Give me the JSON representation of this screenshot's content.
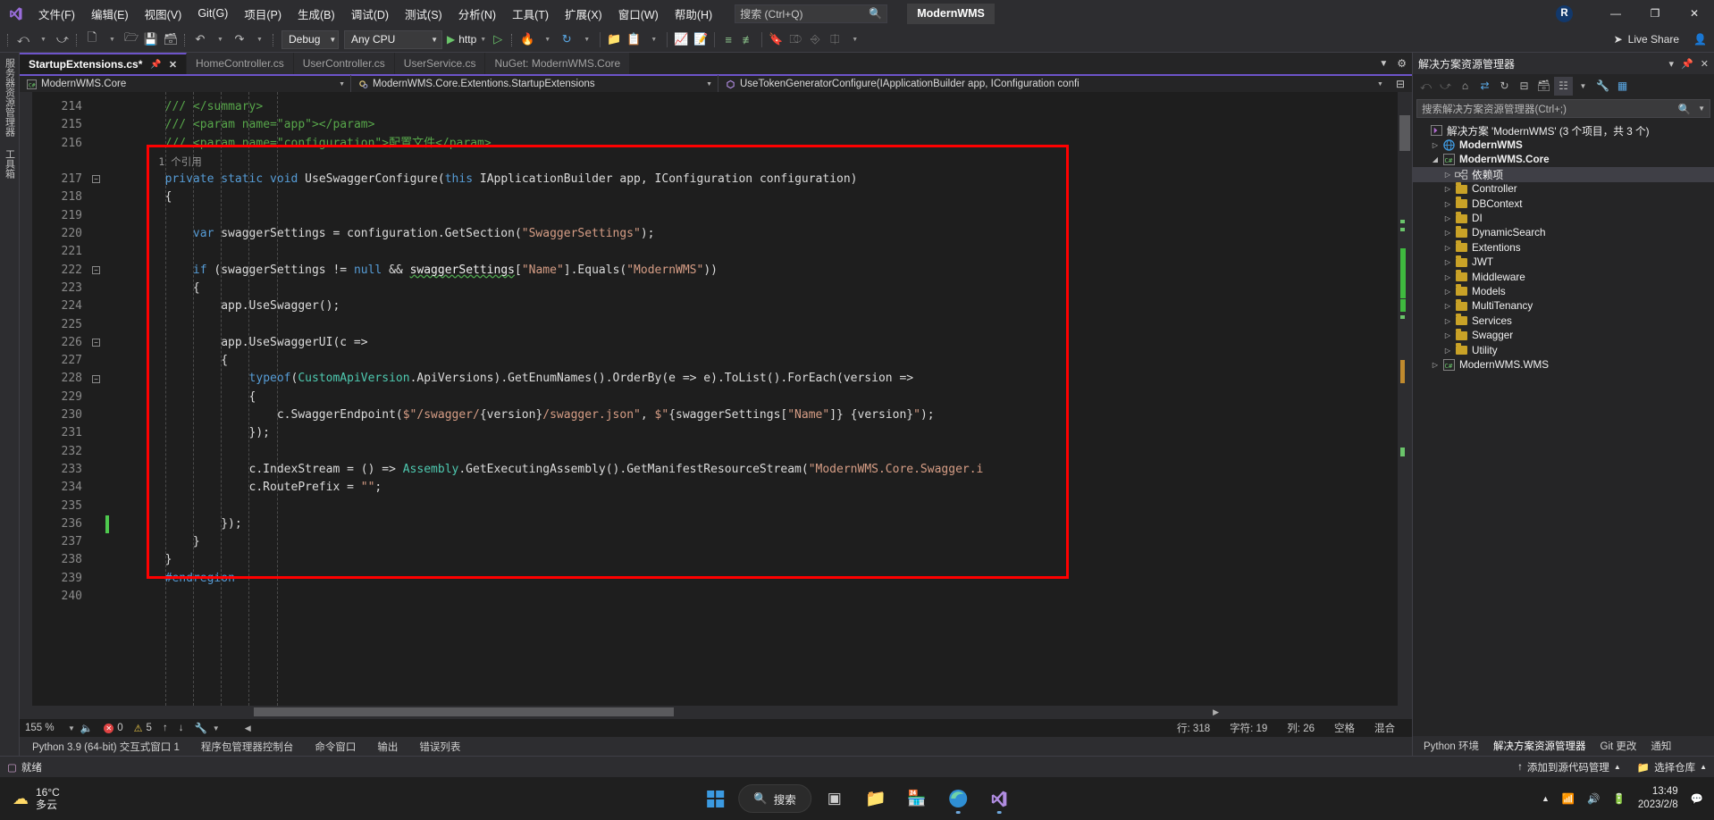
{
  "titlebar": {
    "logo_icon": "visual-studio-logo",
    "menus": [
      "文件(F)",
      "编辑(E)",
      "视图(V)",
      "Git(G)",
      "项目(P)",
      "生成(B)",
      "调试(D)",
      "测试(S)",
      "分析(N)",
      "工具(T)",
      "扩展(X)",
      "窗口(W)",
      "帮助(H)"
    ],
    "search_placeholder": "搜索 (Ctrl+Q)",
    "search_icon": "search-icon",
    "project_badge": "ModernWMS",
    "account_initial": "R",
    "minimize": "—",
    "restore": "❐",
    "close": "✕"
  },
  "toolbar": {
    "nav_back_icon": "navigate-back-icon",
    "nav_fwd_icon": "navigate-forward-icon",
    "new_project_icon": "new-project-icon",
    "open_icon": "open-file-icon",
    "save_icon": "save-icon",
    "save_all_icon": "save-all-icon",
    "undo_icon": "undo-icon",
    "redo_icon": "redo-icon",
    "config_value": "Debug",
    "platform_value": "Any CPU",
    "run_label": "http",
    "run_icon": "play-icon",
    "attach_icon": "attach-process-icon",
    "hotreload_icon": "hot-reload-icon",
    "refresh_icon": "refresh-icon",
    "solution_icon": "solution-explorer-icon",
    "props_icon": "properties-window-icon",
    "bookmark_icon": "bookmark-icon",
    "live_share_label": "Live Share",
    "live_share_icon": "live-share-icon",
    "live_share_people_icon": "people-icon"
  },
  "leftdock": {
    "tabs": [
      "服务器资源管理器",
      "工具箱"
    ]
  },
  "editor": {
    "tabs": [
      {
        "label": "StartupExtensions.cs*",
        "active": true,
        "pin_icon": "pin-icon",
        "close_icon": "close-icon"
      },
      {
        "label": "HomeController.cs",
        "active": false
      },
      {
        "label": "UserController.cs",
        "active": false
      },
      {
        "label": "UserService.cs",
        "active": false
      },
      {
        "label": "NuGet: ModernWMS.Core",
        "active": false
      }
    ],
    "breadcrumb": [
      {
        "icon": "csharp-project-icon",
        "label": "ModernWMS.Core"
      },
      {
        "icon": "class-icon",
        "label": "ModernWMS.Core.Extentions.StartupExtensions"
      },
      {
        "icon": "method-icon",
        "label": "UseTokenGeneratorConfigure(IApplicationBuilder app, IConfiguration confi"
      }
    ],
    "split_icon": "split-editor-icon",
    "lines": [
      {
        "n": "214",
        "fold": false,
        "tokens": [
          {
            "t": "        ",
            "c": "pln"
          },
          {
            "t": "/// </summary>",
            "c": "cmt"
          }
        ]
      },
      {
        "n": "215",
        "fold": false,
        "tokens": [
          {
            "t": "        ",
            "c": "pln"
          },
          {
            "t": "/// <param name=\"app\"></param>",
            "c": "cmt"
          }
        ]
      },
      {
        "n": "216",
        "fold": false,
        "tokens": [
          {
            "t": "        ",
            "c": "pln"
          },
          {
            "t": "/// <param name=\"configuration\">配置文件</param>",
            "c": "cmt"
          }
        ]
      },
      {
        "n": "",
        "fold": false,
        "ref": true,
        "tokens": [
          {
            "t": "        1 个引用",
            "c": "ref"
          }
        ]
      },
      {
        "n": "217",
        "fold": true,
        "tokens": [
          {
            "t": "        ",
            "c": "pln"
          },
          {
            "t": "private",
            "c": "kw"
          },
          {
            "t": " ",
            "c": "pln"
          },
          {
            "t": "static",
            "c": "kw"
          },
          {
            "t": " ",
            "c": "pln"
          },
          {
            "t": "void",
            "c": "kw"
          },
          {
            "t": " UseSwaggerConfigure(",
            "c": "pln"
          },
          {
            "t": "this",
            "c": "kw"
          },
          {
            "t": " IApplicationBuilder app, IConfiguration configuration)",
            "c": "pln"
          }
        ]
      },
      {
        "n": "218",
        "fold": false,
        "tokens": [
          {
            "t": "        {",
            "c": "pln"
          }
        ]
      },
      {
        "n": "219",
        "fold": false,
        "tokens": [
          {
            "t": "",
            "c": "pln"
          }
        ]
      },
      {
        "n": "220",
        "fold": false,
        "tokens": [
          {
            "t": "            ",
            "c": "pln"
          },
          {
            "t": "var",
            "c": "kw"
          },
          {
            "t": " swaggerSettings = configuration.GetSection(",
            "c": "pln"
          },
          {
            "t": "\"SwaggerSettings\"",
            "c": "str"
          },
          {
            "t": ");",
            "c": "pln"
          }
        ]
      },
      {
        "n": "221",
        "fold": false,
        "tokens": [
          {
            "t": "",
            "c": "pln"
          }
        ]
      },
      {
        "n": "222",
        "fold": true,
        "tokens": [
          {
            "t": "            ",
            "c": "pln"
          },
          {
            "t": "if",
            "c": "kw"
          },
          {
            "t": " (swaggerSettings != ",
            "c": "pln"
          },
          {
            "t": "null",
            "c": "kw"
          },
          {
            "t": " && ",
            "c": "pln"
          },
          {
            "t": "swaggerSettings",
            "c": "squig"
          },
          {
            "t": "[",
            "c": "pln"
          },
          {
            "t": "\"Name\"",
            "c": "str"
          },
          {
            "t": "].Equals(",
            "c": "pln"
          },
          {
            "t": "\"ModernWMS\"",
            "c": "str"
          },
          {
            "t": "))",
            "c": "pln"
          }
        ]
      },
      {
        "n": "223",
        "fold": false,
        "tokens": [
          {
            "t": "            {",
            "c": "pln"
          }
        ]
      },
      {
        "n": "224",
        "fold": false,
        "tokens": [
          {
            "t": "                app.UseSwagger();",
            "c": "pln"
          }
        ]
      },
      {
        "n": "225",
        "fold": false,
        "tokens": [
          {
            "t": "",
            "c": "pln"
          }
        ]
      },
      {
        "n": "226",
        "fold": true,
        "tokens": [
          {
            "t": "                app.UseSwaggerUI(c =>",
            "c": "pln"
          }
        ]
      },
      {
        "n": "227",
        "fold": false,
        "tokens": [
          {
            "t": "                {",
            "c": "pln"
          }
        ]
      },
      {
        "n": "228",
        "fold": true,
        "tokens": [
          {
            "t": "                    ",
            "c": "pln"
          },
          {
            "t": "typeof",
            "c": "kw"
          },
          {
            "t": "(",
            "c": "pln"
          },
          {
            "t": "CustomApiVersion",
            "c": "typ"
          },
          {
            "t": ".ApiVersions).GetEnumNames().OrderBy(e => e).ToList().ForEach(version =>",
            "c": "pln"
          }
        ]
      },
      {
        "n": "229",
        "fold": false,
        "tokens": [
          {
            "t": "                    {",
            "c": "pln"
          }
        ]
      },
      {
        "n": "230",
        "fold": false,
        "tokens": [
          {
            "t": "                        c.SwaggerEndpoint(",
            "c": "pln"
          },
          {
            "t": "$\"/swagger/",
            "c": "str"
          },
          {
            "t": "{version}",
            "c": "pln"
          },
          {
            "t": "/swagger.json\"",
            "c": "str"
          },
          {
            "t": ", ",
            "c": "pln"
          },
          {
            "t": "$\"",
            "c": "str"
          },
          {
            "t": "{swaggerSettings[",
            "c": "pln"
          },
          {
            "t": "\"Name\"",
            "c": "str"
          },
          {
            "t": "]} {version}",
            "c": "pln"
          },
          {
            "t": "\"",
            "c": "str"
          },
          {
            "t": ");",
            "c": "pln"
          }
        ]
      },
      {
        "n": "231",
        "fold": false,
        "tokens": [
          {
            "t": "                    });",
            "c": "pln"
          }
        ]
      },
      {
        "n": "232",
        "fold": false,
        "tokens": [
          {
            "t": "",
            "c": "pln"
          }
        ]
      },
      {
        "n": "233",
        "fold": false,
        "tokens": [
          {
            "t": "                    c.IndexStream = () => ",
            "c": "pln"
          },
          {
            "t": "Assembly",
            "c": "typ"
          },
          {
            "t": ".GetExecutingAssembly().GetManifestResourceStream(",
            "c": "pln"
          },
          {
            "t": "\"ModernWMS.Core.Swagger.i",
            "c": "str"
          }
        ]
      },
      {
        "n": "234",
        "fold": false,
        "tokens": [
          {
            "t": "                    c.RoutePrefix = ",
            "c": "pln"
          },
          {
            "t": "\"\"",
            "c": "str"
          },
          {
            "t": ";",
            "c": "pln"
          }
        ]
      },
      {
        "n": "235",
        "fold": false,
        "tokens": [
          {
            "t": "",
            "c": "pln"
          }
        ]
      },
      {
        "n": "236",
        "fold": false,
        "change": "added",
        "tokens": [
          {
            "t": "                });",
            "c": "pln"
          }
        ]
      },
      {
        "n": "237",
        "fold": false,
        "tokens": [
          {
            "t": "            }",
            "c": "pln"
          }
        ]
      },
      {
        "n": "238",
        "fold": false,
        "tokens": [
          {
            "t": "        }",
            "c": "pln"
          }
        ]
      },
      {
        "n": "239",
        "fold": false,
        "tokens": [
          {
            "t": "        ",
            "c": "pln"
          },
          {
            "t": "#endregion",
            "c": "kw"
          }
        ]
      },
      {
        "n": "240",
        "fold": false,
        "tokens": [
          {
            "t": "",
            "c": "pln"
          }
        ]
      }
    ],
    "annotation_box_color": "#ff0000"
  },
  "editor_status": {
    "zoom": "155 %",
    "speaker_icon": "audio-icon",
    "error_count": "0",
    "warning_count": "5",
    "up_arrow_icon": "prev-issue-icon",
    "down_arrow_icon": "next-issue-icon",
    "wrench_icon": "quick-actions-icon",
    "left_arrow_icon": "scroll-left-icon",
    "right_arrow_icon": "scroll-right-icon",
    "line_label": "行: 318",
    "char_label": "字符: 19",
    "col_label": "列: 26",
    "spaces_label": "空格",
    "mixed_label": "混合"
  },
  "bottom_tool_tabs": [
    "Python 3.9 (64-bit) 交互式窗口 1",
    "程序包管理器控制台",
    "命令窗口",
    "输出",
    "错误列表"
  ],
  "solution_explorer": {
    "title": "解决方案资源管理器",
    "float_icon": "float-window-icon",
    "pin_icon": "pin-icon",
    "close_icon": "close-icon",
    "toolbar_icons": [
      "back-icon",
      "forward-icon",
      "home-icon",
      "sync-with-active-document-icon",
      "refresh-icon",
      "collapse-all-icon",
      "show-all-files-icon",
      "view-code-icon",
      "properties-icon",
      "preview-selected-items-icon"
    ],
    "search_placeholder": "搜索解决方案资源管理器(Ctrl+;)",
    "search_icon": "search-icon",
    "filter_icon": "filter-icon",
    "tree": [
      {
        "depth": 0,
        "icon": "solution-icon",
        "label": "解决方案 'ModernWMS' (3 个项目，共 3 个)",
        "expander": "",
        "bold": false,
        "selected": false
      },
      {
        "depth": 1,
        "icon": "web-project-icon",
        "label": "ModernWMS",
        "expander": "▷",
        "bold": true,
        "selected": false
      },
      {
        "depth": 1,
        "icon": "csharp-project-icon",
        "label": "ModernWMS.Core",
        "expander": "◢",
        "bold": true,
        "selected": false
      },
      {
        "depth": 2,
        "icon": "dependencies-icon",
        "label": "依赖项",
        "expander": "▷",
        "bold": false,
        "selected": true
      },
      {
        "depth": 2,
        "icon": "folder-icon",
        "label": "Controller",
        "expander": "▷",
        "bold": false,
        "selected": false
      },
      {
        "depth": 2,
        "icon": "folder-icon",
        "label": "DBContext",
        "expander": "▷",
        "bold": false,
        "selected": false
      },
      {
        "depth": 2,
        "icon": "folder-icon",
        "label": "DI",
        "expander": "▷",
        "bold": false,
        "selected": false
      },
      {
        "depth": 2,
        "icon": "folder-icon",
        "label": "DynamicSearch",
        "expander": "▷",
        "bold": false,
        "selected": false
      },
      {
        "depth": 2,
        "icon": "folder-icon",
        "label": "Extentions",
        "expander": "▷",
        "bold": false,
        "selected": false
      },
      {
        "depth": 2,
        "icon": "folder-icon",
        "label": "JWT",
        "expander": "▷",
        "bold": false,
        "selected": false
      },
      {
        "depth": 2,
        "icon": "folder-icon",
        "label": "Middleware",
        "expander": "▷",
        "bold": false,
        "selected": false
      },
      {
        "depth": 2,
        "icon": "folder-icon",
        "label": "Models",
        "expander": "▷",
        "bold": false,
        "selected": false
      },
      {
        "depth": 2,
        "icon": "folder-icon",
        "label": "MultiTenancy",
        "expander": "▷",
        "bold": false,
        "selected": false
      },
      {
        "depth": 2,
        "icon": "folder-icon",
        "label": "Services",
        "expander": "▷",
        "bold": false,
        "selected": false
      },
      {
        "depth": 2,
        "icon": "folder-icon",
        "label": "Swagger",
        "expander": "▷",
        "bold": false,
        "selected": false
      },
      {
        "depth": 2,
        "icon": "folder-icon",
        "label": "Utility",
        "expander": "▷",
        "bold": false,
        "selected": false
      },
      {
        "depth": 1,
        "icon": "csharp-project-icon",
        "label": "ModernWMS.WMS",
        "expander": "▷",
        "bold": false,
        "selected": false
      }
    ],
    "bottom_tabs": [
      {
        "label": "Python 环境",
        "active": false
      },
      {
        "label": "解决方案资源管理器",
        "active": true
      },
      {
        "label": "Git 更改",
        "active": false
      },
      {
        "label": "通知",
        "active": false
      }
    ]
  },
  "source_bar": {
    "ready_label": "就绪",
    "ready_icon": "ready-icon",
    "add_source_control_label": "添加到源代码管理",
    "add_source_control_icon": "up-arrow-icon",
    "select_repo_label": "选择仓库",
    "select_repo_icon": "repository-icon",
    "caret_icon": "chevron-up-icon"
  },
  "taskbar": {
    "weather_temp": "16°C",
    "weather_desc": "多云",
    "weather_icon": "cloud-icon",
    "start_icon": "windows-start-icon",
    "search_label": "搜索",
    "search_icon": "search-icon",
    "taskview_icon": "task-view-icon",
    "explorer_icon": "file-explorer-icon",
    "store_icon": "microsoft-store-icon",
    "edge_icon": "edge-browser-icon",
    "vs_icon": "visual-studio-icon",
    "chevron_icon": "show-hidden-icons-icon",
    "network_icon": "network-icon",
    "volume_icon": "volume-icon",
    "battery_icon": "battery-icon",
    "time": "13:49",
    "date": "2023/2/8",
    "notification_icon": "notifications-icon"
  },
  "colors": {
    "accent_purple": "#6d54c9",
    "annotation_red": "#ff0000",
    "chrome_bg": "#2d2d30",
    "editor_bg": "#1e1e1e",
    "panel_bg": "#252526"
  }
}
